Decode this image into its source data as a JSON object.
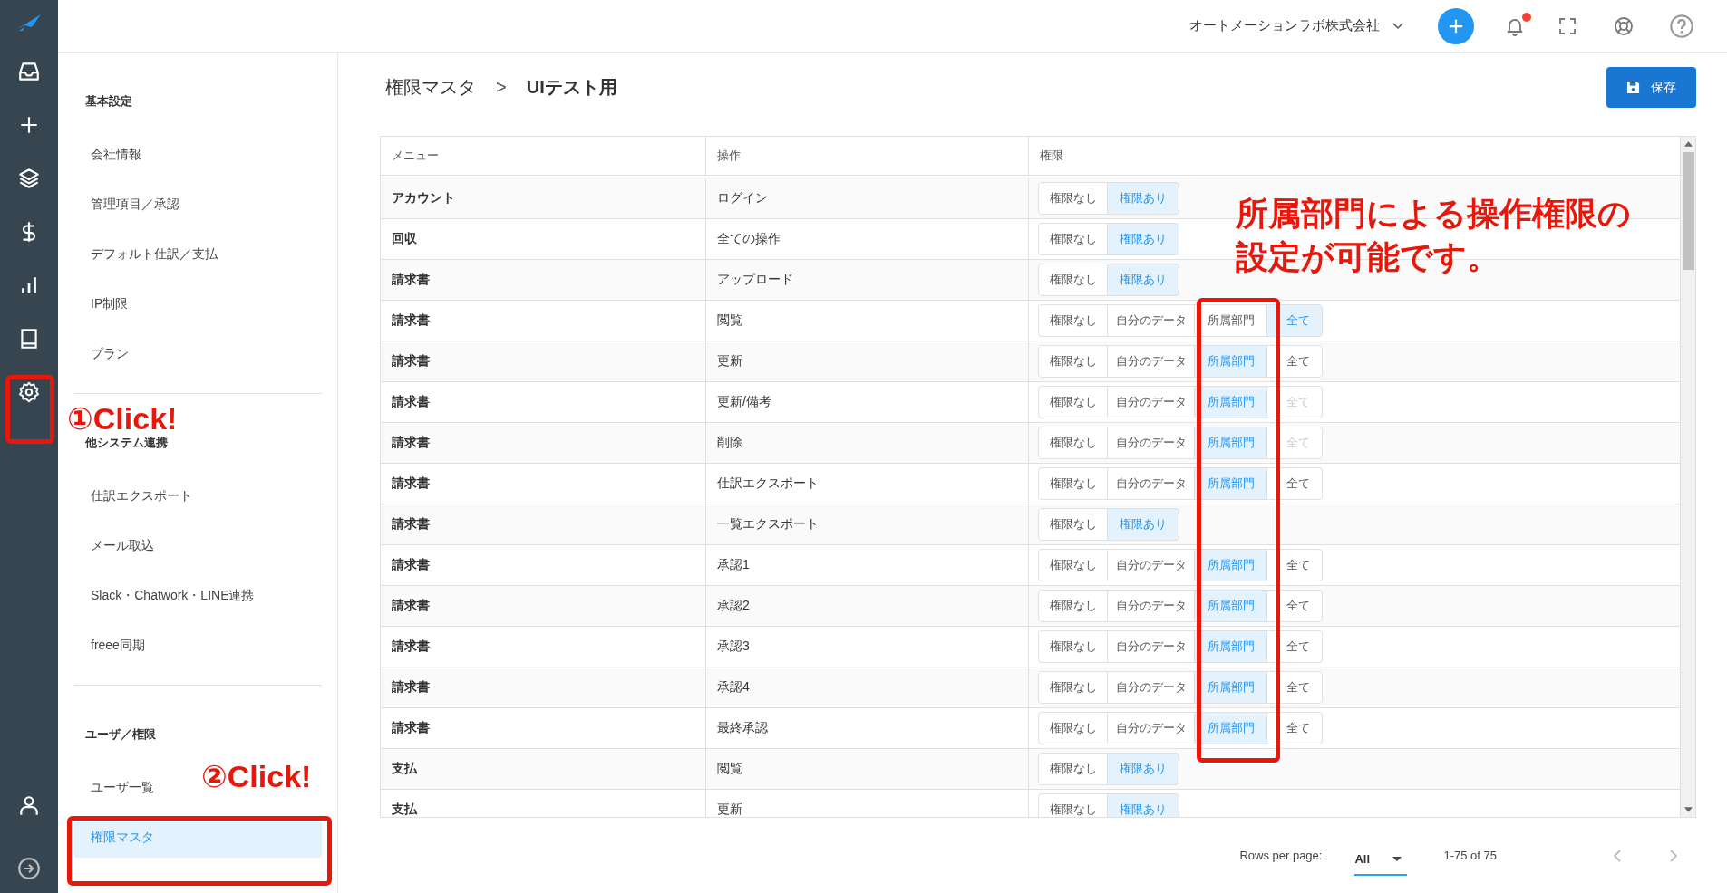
{
  "topbar": {
    "company": "オートメーションラボ株式会社",
    "notifications_unread": true
  },
  "sidebar": {
    "sections": [
      {
        "heading": "基本設定",
        "items": [
          {
            "label": "会社情報",
            "selected": false
          },
          {
            "label": "管理項目／承認",
            "selected": false
          },
          {
            "label": "デフォルト仕訳／支払",
            "selected": false
          },
          {
            "label": "IP制限",
            "selected": false
          },
          {
            "label": "プラン",
            "selected": false
          }
        ]
      },
      {
        "heading": "他システム連携",
        "items": [
          {
            "label": "仕訳エクスポート",
            "selected": false
          },
          {
            "label": "メール取込",
            "selected": false
          },
          {
            "label": "Slack・Chatwork・LINE連携",
            "selected": false
          },
          {
            "label": "freee同期",
            "selected": false
          }
        ]
      },
      {
        "heading": "ユーザ／権限",
        "items": [
          {
            "label": "ユーザ一覧",
            "selected": false
          },
          {
            "label": "権限マスタ",
            "selected": true
          }
        ]
      }
    ]
  },
  "breadcrumb": {
    "parent": "権限マスタ",
    "separator": ">",
    "current": "UIテスト用"
  },
  "save_button": "保存",
  "table": {
    "columns": [
      "メニュー",
      "操作",
      "権限"
    ],
    "rows": [
      {
        "menu": "アカウント",
        "operation": "ログイン",
        "options": [
          {
            "label": "権限なし",
            "selected": false,
            "disabled": false
          },
          {
            "label": "権限あり",
            "selected": true,
            "disabled": false
          }
        ]
      },
      {
        "menu": "回収",
        "operation": "全ての操作",
        "options": [
          {
            "label": "権限なし",
            "selected": false,
            "disabled": false
          },
          {
            "label": "権限あり",
            "selected": true,
            "disabled": false
          }
        ]
      },
      {
        "menu": "請求書",
        "operation": "アップロード",
        "options": [
          {
            "label": "権限なし",
            "selected": false,
            "disabled": false
          },
          {
            "label": "権限あり",
            "selected": true,
            "disabled": false
          }
        ]
      },
      {
        "menu": "請求書",
        "operation": "閲覧",
        "options": [
          {
            "label": "権限なし",
            "selected": false,
            "disabled": false
          },
          {
            "label": "自分のデータ",
            "selected": false,
            "disabled": false
          },
          {
            "label": "所属部門",
            "selected": false,
            "disabled": false
          },
          {
            "label": "全て",
            "selected": true,
            "disabled": false
          }
        ]
      },
      {
        "menu": "請求書",
        "operation": "更新",
        "options": [
          {
            "label": "権限なし",
            "selected": false,
            "disabled": false
          },
          {
            "label": "自分のデータ",
            "selected": false,
            "disabled": false
          },
          {
            "label": "所属部門",
            "selected": true,
            "disabled": false
          },
          {
            "label": "全て",
            "selected": false,
            "disabled": false
          }
        ]
      },
      {
        "menu": "請求書",
        "operation": "更新/備考",
        "options": [
          {
            "label": "権限なし",
            "selected": false,
            "disabled": false
          },
          {
            "label": "自分のデータ",
            "selected": false,
            "disabled": false
          },
          {
            "label": "所属部門",
            "selected": true,
            "disabled": false
          },
          {
            "label": "全て",
            "selected": false,
            "disabled": true
          }
        ]
      },
      {
        "menu": "請求書",
        "operation": "削除",
        "options": [
          {
            "label": "権限なし",
            "selected": false,
            "disabled": false
          },
          {
            "label": "自分のデータ",
            "selected": false,
            "disabled": false
          },
          {
            "label": "所属部門",
            "selected": true,
            "disabled": false
          },
          {
            "label": "全て",
            "selected": false,
            "disabled": true
          }
        ]
      },
      {
        "menu": "請求書",
        "operation": "仕訳エクスポート",
        "options": [
          {
            "label": "権限なし",
            "selected": false,
            "disabled": false
          },
          {
            "label": "自分のデータ",
            "selected": false,
            "disabled": false
          },
          {
            "label": "所属部門",
            "selected": true,
            "disabled": false
          },
          {
            "label": "全て",
            "selected": false,
            "disabled": false
          }
        ]
      },
      {
        "menu": "請求書",
        "operation": "一覧エクスポート",
        "options": [
          {
            "label": "権限なし",
            "selected": false,
            "disabled": false
          },
          {
            "label": "権限あり",
            "selected": true,
            "disabled": false
          }
        ]
      },
      {
        "menu": "請求書",
        "operation": "承認1",
        "options": [
          {
            "label": "権限なし",
            "selected": false,
            "disabled": false
          },
          {
            "label": "自分のデータ",
            "selected": false,
            "disabled": false
          },
          {
            "label": "所属部門",
            "selected": true,
            "disabled": false
          },
          {
            "label": "全て",
            "selected": false,
            "disabled": false
          }
        ]
      },
      {
        "menu": "請求書",
        "operation": "承認2",
        "options": [
          {
            "label": "権限なし",
            "selected": false,
            "disabled": false
          },
          {
            "label": "自分のデータ",
            "selected": false,
            "disabled": false
          },
          {
            "label": "所属部門",
            "selected": true,
            "disabled": false
          },
          {
            "label": "全て",
            "selected": false,
            "disabled": false
          }
        ]
      },
      {
        "menu": "請求書",
        "operation": "承認3",
        "options": [
          {
            "label": "権限なし",
            "selected": false,
            "disabled": false
          },
          {
            "label": "自分のデータ",
            "selected": false,
            "disabled": false
          },
          {
            "label": "所属部門",
            "selected": true,
            "disabled": false
          },
          {
            "label": "全て",
            "selected": false,
            "disabled": false
          }
        ]
      },
      {
        "menu": "請求書",
        "operation": "承認4",
        "options": [
          {
            "label": "権限なし",
            "selected": false,
            "disabled": false
          },
          {
            "label": "自分のデータ",
            "selected": false,
            "disabled": false
          },
          {
            "label": "所属部門",
            "selected": true,
            "disabled": false
          },
          {
            "label": "全て",
            "selected": false,
            "disabled": false
          }
        ]
      },
      {
        "menu": "請求書",
        "operation": "最終承認",
        "options": [
          {
            "label": "権限なし",
            "selected": false,
            "disabled": false
          },
          {
            "label": "自分のデータ",
            "selected": false,
            "disabled": false
          },
          {
            "label": "所属部門",
            "selected": true,
            "disabled": false
          },
          {
            "label": "全て",
            "selected": false,
            "disabled": false
          }
        ]
      },
      {
        "menu": "支払",
        "operation": "閲覧",
        "options": [
          {
            "label": "権限なし",
            "selected": false,
            "disabled": false
          },
          {
            "label": "権限あり",
            "selected": true,
            "disabled": false
          }
        ]
      },
      {
        "menu": "支払",
        "operation": "更新",
        "options": [
          {
            "label": "権限なし",
            "selected": false,
            "disabled": false
          },
          {
            "label": "権限あり",
            "selected": true,
            "disabled": false
          }
        ]
      }
    ]
  },
  "pagination": {
    "rows_per_page_label": "Rows per page:",
    "rows_per_page": "All",
    "range": "1-75 of 75"
  },
  "annotations": {
    "note_lines": [
      "所属部門による操作権限の",
      "設定が可能です。"
    ],
    "steps": [
      "①Click!",
      "②Click!"
    ]
  }
}
